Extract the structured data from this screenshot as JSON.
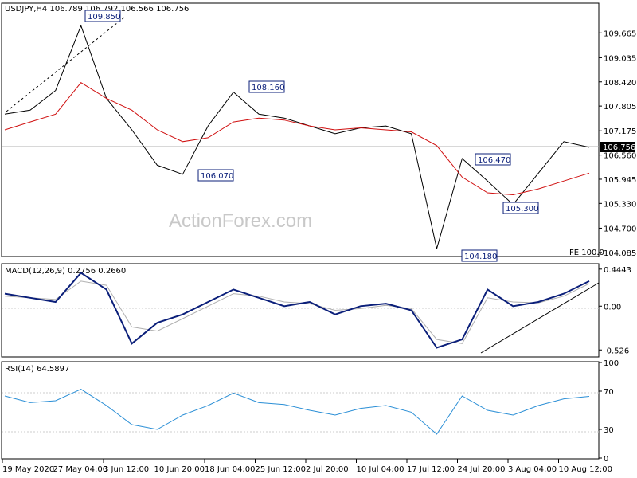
{
  "colors": {
    "price": "#000000",
    "ma": "#d01010",
    "macd": "#0b1f7a",
    "signal": "#b0b0b0",
    "rsi": "#2b8fd6",
    "grid": "#cccccc",
    "label_border": "#0b1f7a",
    "trendline": "#000000"
  },
  "header": {
    "price_title": "USDJPY,H4  106.789 106.792 106.566 106.756",
    "macd_title": "MACD(12,26,9) 0.2756 0.2660",
    "rsi_title": "RSI(14) 64.5897"
  },
  "watermark": "ActionForex.com",
  "fe_label": "FE 100.0",
  "price_axis_labels": [
    "109.665",
    "109.035",
    "108.420",
    "107.805",
    "107.175",
    "106.560",
    "105.945",
    "105.330",
    "104.700",
    "104.085"
  ],
  "current_price": "106.756",
  "macd_axis_labels": [
    "0.4443",
    "0.00",
    "-0.526"
  ],
  "rsi_axis_labels": [
    "100",
    "70",
    "30",
    "0"
  ],
  "x_axis_labels": [
    "19 May 2020",
    "27 May 04:00",
    "3 Jun 12:00",
    "10 Jun 20:00",
    "18 Jun 04:00",
    "25 Jun 12:00",
    "2 Jul 20:00",
    "10 Jul 04:00",
    "17 Jul 12:00",
    "24 Jul 20:00",
    "3 Aug 04:00",
    "10 Aug 12:00"
  ],
  "annotations": [
    "109.850",
    "108.160",
    "106.070",
    "106.470",
    "105.300",
    "104.180"
  ],
  "chart_data": {
    "type": "line",
    "price_axis": {
      "min": 104.0,
      "max": 110.4,
      "ticks": [
        109.665,
        109.035,
        108.42,
        107.805,
        107.175,
        106.56,
        105.945,
        105.33,
        104.7,
        104.085
      ]
    },
    "x": [
      "19 May 2020",
      "27 May 04:00",
      "3 Jun 12:00",
      "10 Jun 20:00",
      "18 Jun 04:00",
      "25 Jun 12:00",
      "2 Jul 20:00",
      "10 Jul 04:00",
      "17 Jul 12:00",
      "24 Jul 20:00",
      "3 Aug 04:00",
      "10 Aug 12:00"
    ],
    "price": [
      107.6,
      107.7,
      108.2,
      109.85,
      108.0,
      107.2,
      106.3,
      106.07,
      107.3,
      108.16,
      107.6,
      107.5,
      107.3,
      107.1,
      107.25,
      107.3,
      107.1,
      104.18,
      106.47,
      105.9,
      105.3,
      106.1,
      106.9,
      106.756
    ],
    "ma": [
      107.2,
      107.4,
      107.6,
      108.4,
      108.0,
      107.7,
      107.2,
      106.9,
      107.0,
      107.4,
      107.5,
      107.45,
      107.3,
      107.2,
      107.25,
      107.2,
      107.15,
      106.8,
      106.0,
      105.6,
      105.55,
      105.7,
      105.9,
      106.1
    ],
    "annotations": [
      {
        "label": "109.850",
        "value": 109.85
      },
      {
        "label": "108.160",
        "value": 108.16
      },
      {
        "label": "106.070",
        "value": 106.07
      },
      {
        "label": "106.470",
        "value": 106.47
      },
      {
        "label": "105.300",
        "value": 105.3
      },
      {
        "label": "104.180",
        "value": 104.18
      }
    ],
    "macd": {
      "axis": {
        "min": -0.6,
        "max": 0.5,
        "ticks": [
          0.4443,
          0.0,
          -0.526
        ]
      },
      "macd": [
        0.15,
        0.1,
        0.05,
        0.4,
        0.2,
        -0.45,
        -0.2,
        -0.1,
        0.05,
        0.2,
        0.1,
        0.0,
        0.05,
        -0.1,
        0.0,
        0.03,
        -0.05,
        -0.5,
        -0.4,
        0.2,
        0.0,
        0.05,
        0.15,
        0.3
      ],
      "signal": [
        0.12,
        0.1,
        0.08,
        0.3,
        0.25,
        -0.25,
        -0.3,
        -0.15,
        0.0,
        0.15,
        0.12,
        0.05,
        0.03,
        -0.05,
        -0.03,
        0.01,
        -0.03,
        -0.4,
        -0.45,
        0.1,
        0.05,
        0.04,
        0.12,
        0.27
      ]
    },
    "rsi": {
      "axis": {
        "min": 0,
        "max": 100,
        "ticks": [
          100,
          70,
          30,
          0
        ],
        "levels": [
          70,
          30
        ]
      },
      "values": [
        65,
        58,
        60,
        72,
        55,
        35,
        30,
        45,
        55,
        68,
        58,
        56,
        50,
        45,
        52,
        55,
        48,
        25,
        65,
        50,
        45,
        55,
        62,
        64.59
      ]
    }
  }
}
